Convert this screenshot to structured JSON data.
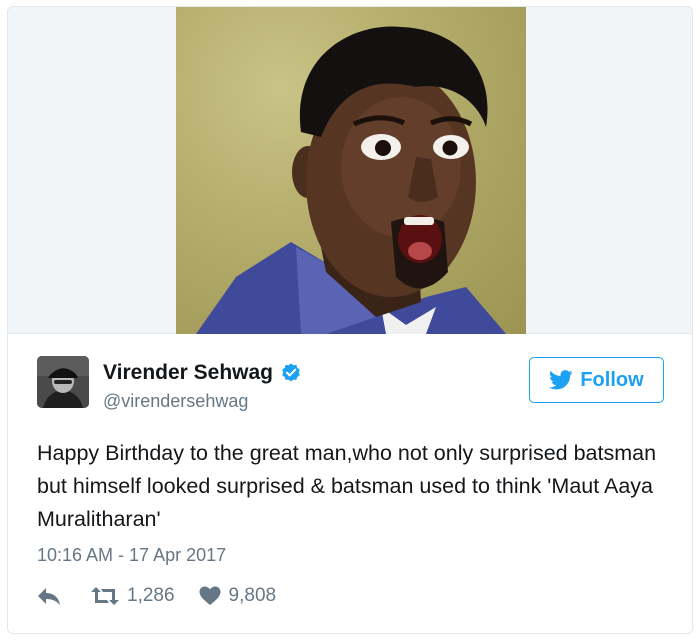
{
  "tweet": {
    "author_name": "Virender Sehwag",
    "author_handle": "@virendersehwag",
    "follow_label": "Follow",
    "text": "Happy Birthday to the great man,who not only surprised batsman but himself looked surprised & batsman used to think 'Maut Aaya Muralitharan'",
    "timestamp": "10:16 AM - 17 Apr 2017",
    "retweet_count": "1,286",
    "like_count": "9,808"
  },
  "icons": {
    "verified": "verified-badge-icon",
    "follow": "twitter-bird-icon",
    "reply": "reply-icon",
    "retweet": "retweet-icon",
    "like": "heart-icon"
  },
  "colors": {
    "accent": "#1da1f2",
    "text": "#14171a",
    "muted": "#657786",
    "border": "#e1e8ed"
  }
}
